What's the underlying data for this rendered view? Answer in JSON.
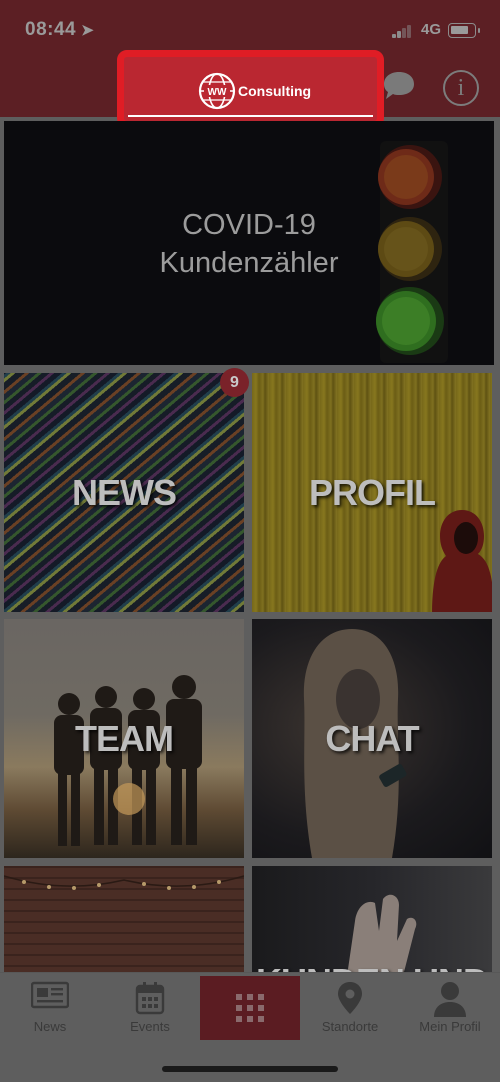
{
  "status_bar": {
    "time": "08:44",
    "network": "4G",
    "location_icon": "location-arrow-icon",
    "signal_icon": "signal-bars-icon",
    "battery_icon": "battery-icon"
  },
  "header": {
    "logo_mark": "WW",
    "logo_text": "Consulting",
    "chat_icon": "chat-bubble-icon",
    "info_label": "i",
    "colors": {
      "header_bg": "#5c1f24",
      "logo_bg": "#ba2731",
      "highlight_border": "#e01d25"
    }
  },
  "tiles": {
    "covid": {
      "line1": "COVID-19",
      "line2": "Kundenzähler"
    },
    "news": {
      "label": "NEWS",
      "badge": "9"
    },
    "profil": {
      "label": "PROFIL"
    },
    "team": {
      "label": "TEAM"
    },
    "chat": {
      "label": "CHAT"
    },
    "kunden": {
      "label": "KUNDEN UND"
    }
  },
  "tabbar": {
    "news": "News",
    "events": "Events",
    "standorte": "Standorte",
    "profil": "Mein Profil",
    "home_icon": "grid-dots-icon",
    "active_color": "#5b1c22"
  }
}
